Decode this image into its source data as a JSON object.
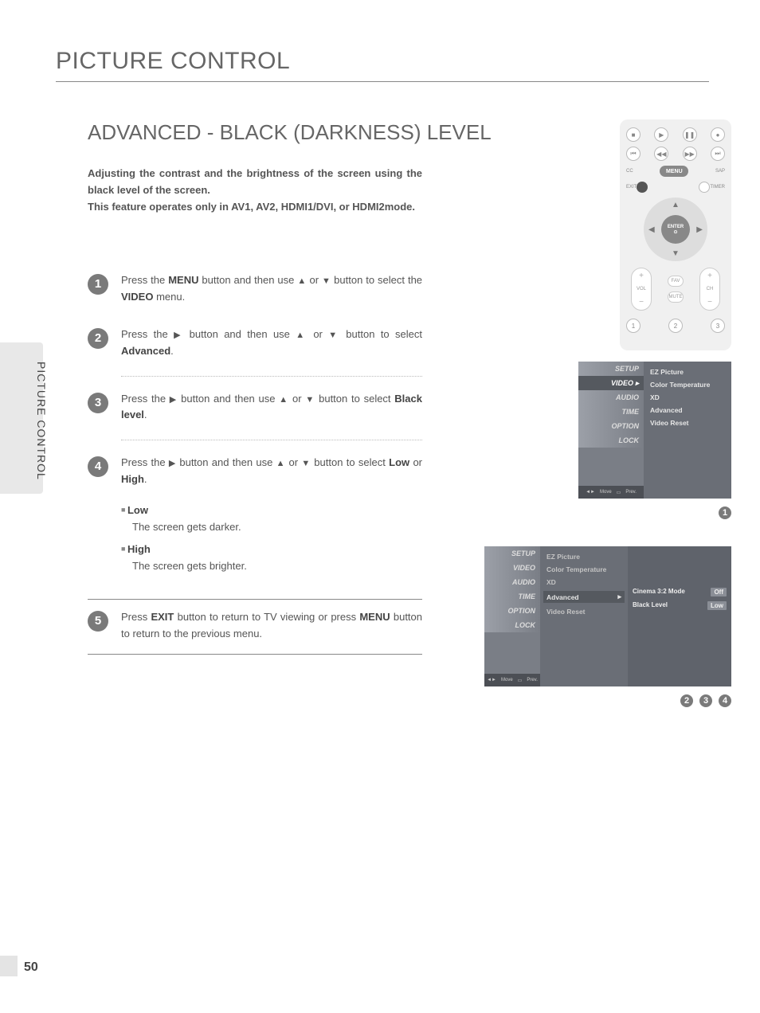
{
  "sidebar_label": "PICTURE CONTROL",
  "section_title": "PICTURE CONTROL",
  "sub_title": "ADVANCED - BLACK (DARKNESS) LEVEL",
  "intro_line1": "Adjusting the contrast and the brightness of the screen using the black level of the screen.",
  "intro_line2": "This feature operates only in AV1, AV2, HDMI1/DVI, or HDMI2mode.",
  "remote": {
    "cc": "CC",
    "menu": "MENU",
    "sap": "SAP",
    "exit": "EXIT",
    "timer": "TIMER",
    "enter": "ENTER",
    "enter_sym": "⊙",
    "vol": "VOL",
    "ch": "CH",
    "fav": "FAV",
    "mute": "MUTE",
    "n1": "1",
    "n2": "2",
    "n3": "3",
    "play": "▶",
    "pause": "❚❚",
    "stop": "■",
    "rec": "●",
    "prev": "⏮",
    "rew": "◀◀",
    "ff": "▶▶",
    "next": "⏭"
  },
  "steps": {
    "s1a": "Press the ",
    "s1_menu": "MENU",
    "s1b": " button and then use ",
    "s1c": " or ",
    "s1d": " button to select the ",
    "s1_video": "VIDEO",
    "s1e": " menu.",
    "s2a": "Press the ",
    "s2b": " button and then use ",
    "s2c": " or ",
    "s2d": " button to select ",
    "s2_adv": "Advanced",
    "s2e": ".",
    "s3a": "Press the ",
    "s3b": " button and then use ",
    "s3c": " or ",
    "s3d": " button to select ",
    "s3_bl": "Black level",
    "s3e": ".",
    "s4a": "Press the ",
    "s4b": " button and then use ",
    "s4c": " or ",
    "s4d": " button to select ",
    "s4_low": "Low",
    "s4_or": " or ",
    "s4_high": "High",
    "s4e": ".",
    "s5a": "Press ",
    "s5_exit": "EXIT",
    "s5b": " button to return to TV viewing or press ",
    "s5_menu": "MENU",
    "s5c": " button to return to the previous menu."
  },
  "options": {
    "low_label": "Low",
    "low_desc": "The screen gets darker.",
    "high_label": "High",
    "high_desc": "The screen gets brighter."
  },
  "osd_menu": {
    "side": [
      "SETUP",
      "VIDEO",
      "AUDIO",
      "TIME",
      "OPTION",
      "LOCK"
    ],
    "footer_move": "Move",
    "footer_prev": "Prev.",
    "pane": [
      "EZ Picture",
      "Color Temperature",
      "XD",
      "Advanced",
      "Video Reset"
    ],
    "advanced_sub": {
      "cinema": "Cinema 3:2 Mode",
      "cinema_val": "Off",
      "black": "Black Level",
      "black_val": "Low"
    }
  },
  "badges": {
    "b1": "1",
    "b2": "2",
    "b3": "3",
    "b4": "4",
    "b5": "5"
  },
  "page_number": "50",
  "glyph": {
    "up": "▲",
    "down": "▼",
    "right": "▶",
    "left": "◀",
    "caret": "▸"
  }
}
